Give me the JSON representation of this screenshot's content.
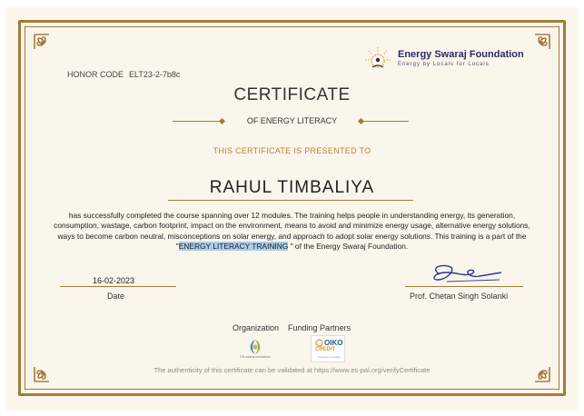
{
  "honor": {
    "label": "HONOR CODE",
    "code": "ELT23-2-7b8c"
  },
  "brand": {
    "name": "Energy Swaraj Foundation",
    "tagline": "Energy by Locals for Locals",
    "primary_color": "#2b2b5e",
    "accent_color": "#f0a43a"
  },
  "certificate": {
    "title": "CERTIFICATE",
    "subtitle": "OF ENERGY LITERACY",
    "presented_line": "THIS CERTIFICATE IS PRESENTED TO",
    "recipient": "RAHUL TIMBALIYA",
    "body_before": "has successfully completed the course spanning over 12 modules. The training helps people in understanding energy, its generation, consumption, wastage, carbon footprint, impact on the environment, means to avoid and minimize energy usage, alternative energy solutions, ways to become carbon neutral, misconceptions on solar energy, and approach to adopt solar energy solutions. This training is a part of the \"",
    "body_highlight": "ENERGY LITERACY TRAINING",
    "body_after": " \" of the Energy Swaraj Foundation."
  },
  "date": {
    "value": "16-02-2023",
    "label": "Date"
  },
  "signatory": {
    "name": "Prof. Chetan Singh Solanki"
  },
  "partners": {
    "organization_label": "Organization",
    "funding_label": "Funding Partners",
    "organization_logo_caption": "EN swaraj foundation",
    "funding_logo": {
      "name": "OIKO",
      "sub": "CREDIT",
      "caption": "investing in people"
    }
  },
  "footer": "The authenticity of this certificate can be validated at https://www.es-pal.org/verifyCertificate",
  "colors": {
    "frame": "#a57a3c",
    "paper": "#fbf6ec",
    "gold_text": "#b5833a",
    "highlight": "#a9cdea"
  }
}
